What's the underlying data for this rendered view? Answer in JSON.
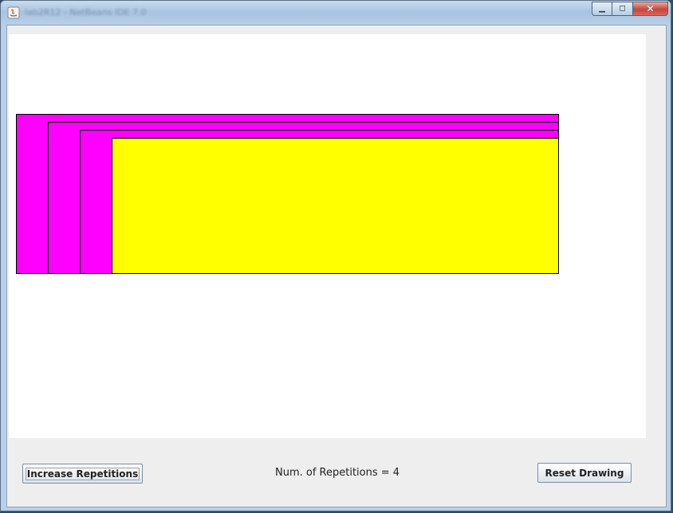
{
  "window": {
    "title": "lab2R12 - NetBeans IDE 7.0"
  },
  "titlebar": {
    "minimize_glyph": "▁",
    "maximize_glyph": "◻",
    "close_glyph": "✕",
    "icons": [
      "java-app-icon",
      "minimize-icon",
      "maximize-icon",
      "close-icon"
    ]
  },
  "drawing": {
    "repetitions": 4,
    "outer_color": "#FF00FF",
    "inner_color": "#FFFF00",
    "outline_color": "#000000",
    "background": "#FFFFFF"
  },
  "controls": {
    "increase_label": "Increase Repetitions",
    "status_text": "Num. of Repetitions = 4",
    "reset_label": "Reset Drawing"
  }
}
